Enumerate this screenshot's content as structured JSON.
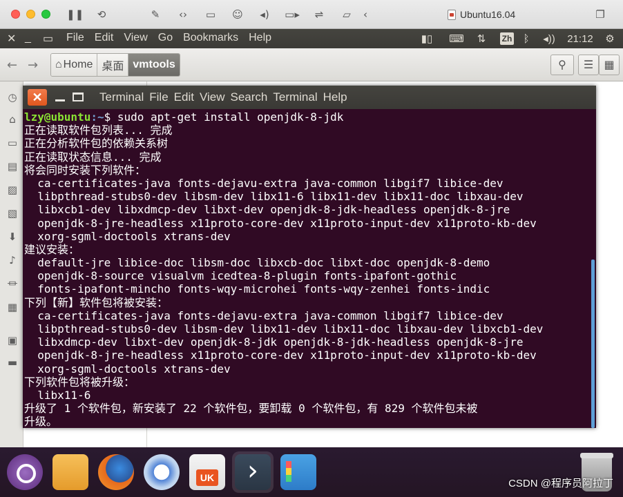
{
  "mac_window": {
    "title": "Ubuntu16.04",
    "toolbar_icons": [
      "pause-icon",
      "snapshot-icon",
      "settings-wrench-icon",
      "code-icon",
      "hdd-icon",
      "user-icon",
      "sound-icon",
      "camera-icon",
      "usb-icon",
      "folder-share-icon",
      "back-chevron-icon"
    ]
  },
  "ubuntu_panel": {
    "menus": [
      "File",
      "Edit",
      "View",
      "Go",
      "Bookmarks",
      "Help"
    ],
    "input_method": "Zh",
    "clock": "21:12"
  },
  "nautilus": {
    "breadcrumbs": [
      {
        "label": "Home",
        "icon": "home-icon"
      },
      {
        "label": "桌面"
      },
      {
        "label": "vmtools",
        "active": true
      }
    ]
  },
  "terminal": {
    "menus": [
      "Terminal",
      "File",
      "Edit",
      "View",
      "Search",
      "Terminal",
      "Help"
    ],
    "prompt_user": "lzy@ubuntu",
    "prompt_path": ":~",
    "prompt_symbol": "$ ",
    "command": "sudo apt-get install openjdk-8-jdk",
    "output_lines": [
      "正在读取软件包列表... 完成",
      "正在分析软件包的依赖关系树",
      "正在读取状态信息... 完成",
      "将会同时安装下列软件：",
      "  ca-certificates-java fonts-dejavu-extra java-common libgif7 libice-dev",
      "  libpthread-stubs0-dev libsm-dev libx11-6 libx11-dev libx11-doc libxau-dev",
      "  libxcb1-dev libxdmcp-dev libxt-dev openjdk-8-jdk-headless openjdk-8-jre",
      "  openjdk-8-jre-headless x11proto-core-dev x11proto-input-dev x11proto-kb-dev",
      "  xorg-sgml-doctools xtrans-dev",
      "建议安装：",
      "  default-jre libice-doc libsm-doc libxcb-doc libxt-doc openjdk-8-demo",
      "  openjdk-8-source visualvm icedtea-8-plugin fonts-ipafont-gothic",
      "  fonts-ipafont-mincho fonts-wqy-microhei fonts-wqy-zenhei fonts-indic",
      "下列【新】软件包将被安装：",
      "  ca-certificates-java fonts-dejavu-extra java-common libgif7 libice-dev",
      "  libpthread-stubs0-dev libsm-dev libx11-dev libx11-doc libxau-dev libxcb1-dev",
      "  libxdmcp-dev libxt-dev openjdk-8-jdk openjdk-8-jdk-headless openjdk-8-jre",
      "  openjdk-8-jre-headless x11proto-core-dev x11proto-input-dev x11proto-kb-dev",
      "  xorg-sgml-doctools xtrans-dev",
      "下列软件包将被升级：",
      "  libx11-6",
      "升级了 1 个软件包，新安装了 22 个软件包，要卸载 0 个软件包，有 829 个软件包未被",
      "升级。"
    ]
  },
  "dock": {
    "items": [
      "ubuntu-dash-icon",
      "files-icon",
      "firefox-icon",
      "web-browser-icon",
      "software-store-icon",
      "terminal-app-icon",
      "apps-icon",
      "trash-icon"
    ]
  },
  "watermark": "CSDN @程序员阿拉丁"
}
